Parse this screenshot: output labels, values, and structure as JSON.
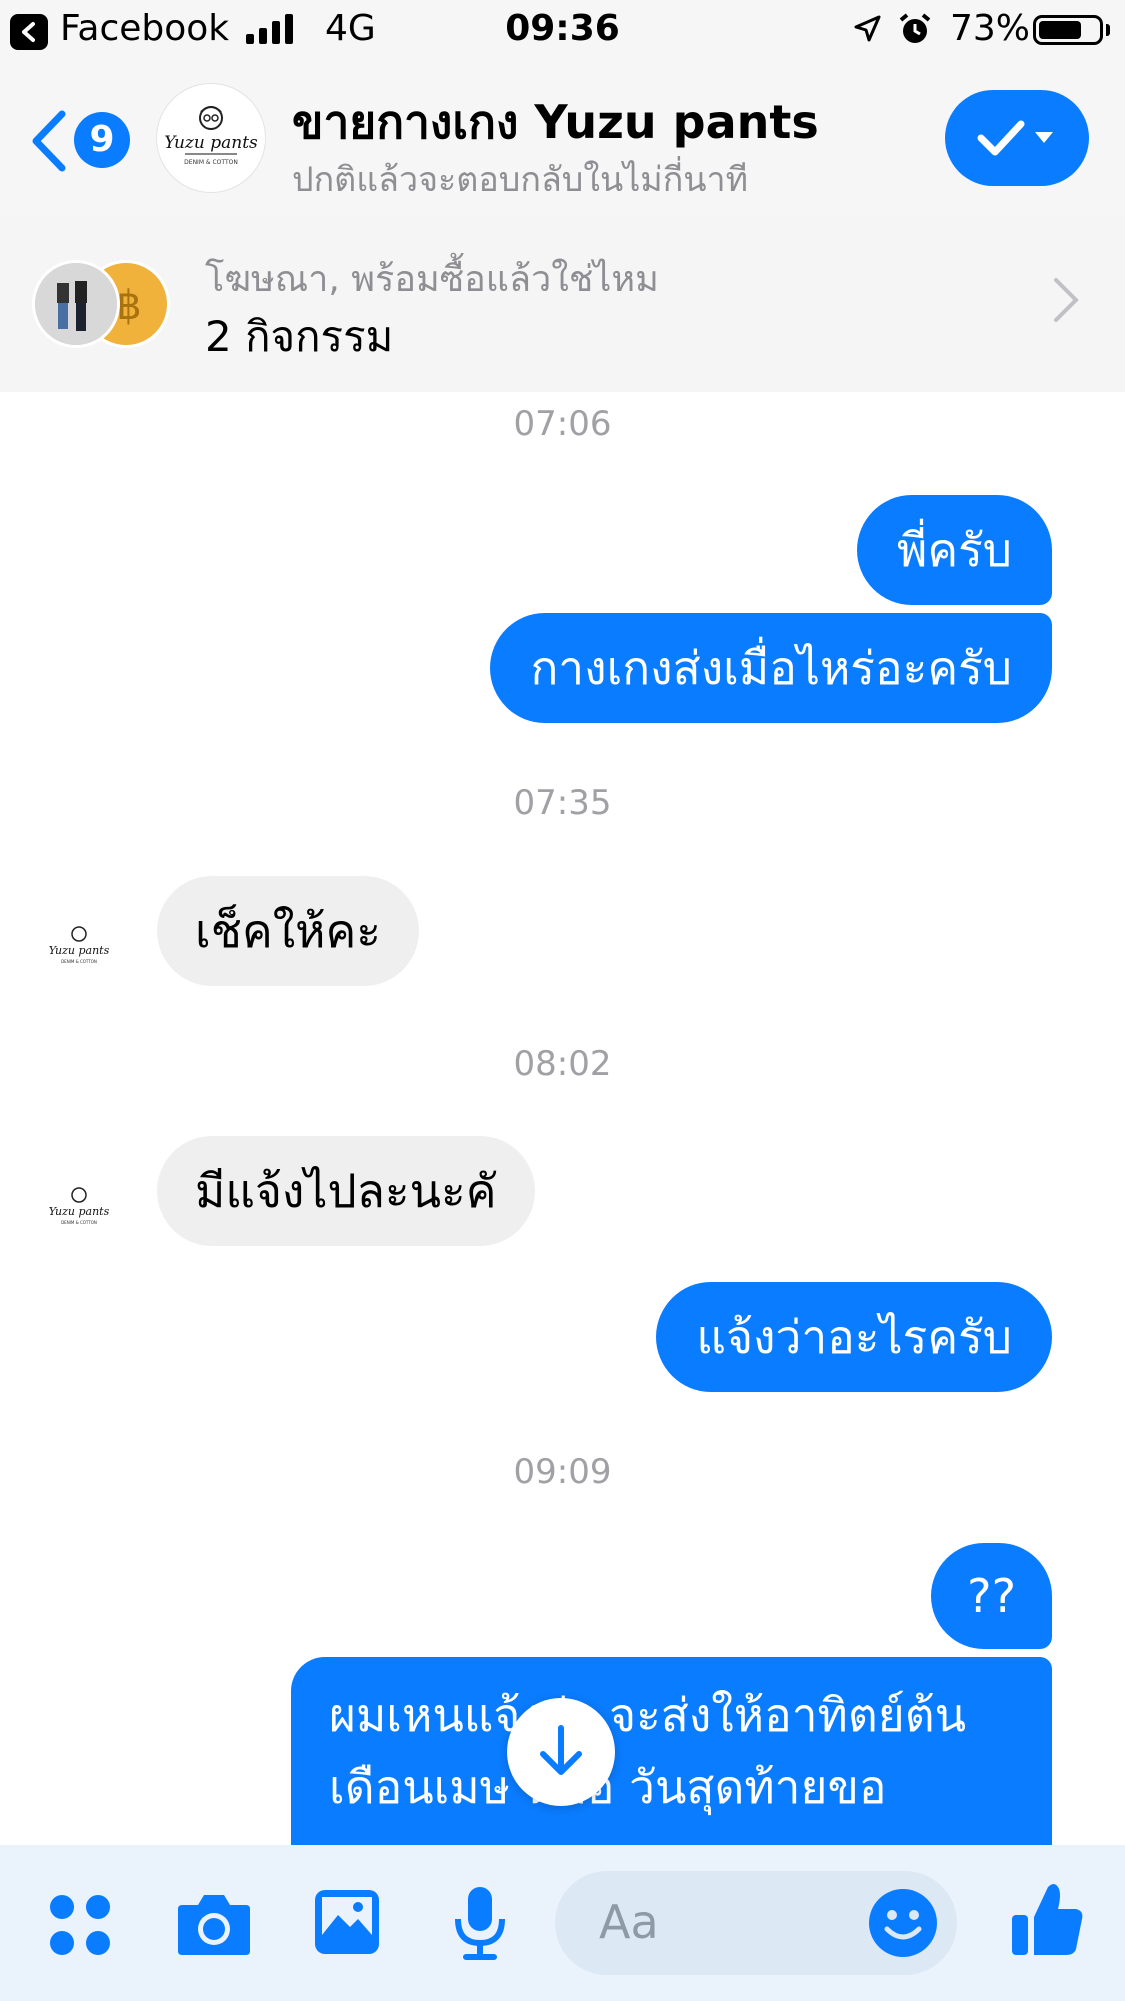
{
  "status_bar": {
    "back_app": "Facebook",
    "network": "4G",
    "time": "09:36",
    "battery_pct": "73%",
    "battery_level": 0.73
  },
  "header": {
    "back_count": "9",
    "title": "ขายกางเกง Yuzu pants",
    "subtitle": "ปกติแล้วจะตอบกลับในไม่กี่นาที",
    "avatar_brand": "Yuzu pants",
    "avatar_small": "DENIM & COTTON"
  },
  "ad_banner": {
    "line1": "โฆษณา, พร้อมซื้อแล้วใช่ไหม",
    "line2": "2 กิจกรรม"
  },
  "messages": [
    {
      "type": "time",
      "text": "07:06"
    },
    {
      "type": "out",
      "text": "พี่ครับ"
    },
    {
      "type": "out",
      "text": "กางเกงส่งเมื่อไหร่อะครับ"
    },
    {
      "type": "time",
      "text": "07:35"
    },
    {
      "type": "in",
      "text": "เช็คให้คะ"
    },
    {
      "type": "time",
      "text": "08:02"
    },
    {
      "type": "in",
      "text": "มีแจ้งไปละนะคั"
    },
    {
      "type": "out",
      "text": "แจ้งว่าอะไรครับ"
    },
    {
      "type": "time",
      "text": "09:09"
    },
    {
      "type": "out",
      "text": "??"
    },
    {
      "type": "out",
      "line1": "ผมเหนแจ้งว่า จะส่งให้อาทิตย์ต้น",
      "line2": "เดือนเมษ นี้คือ วันสุดท้ายขอ"
    }
  ],
  "composer": {
    "placeholder": "Aa"
  },
  "colors": {
    "accent": "#0a7cff",
    "incoming_bubble": "#efefef",
    "timestamp": "#a0a0a5"
  },
  "icons": [
    "back-chevron-icon",
    "checkmark-icon",
    "chevron-right-icon",
    "arrow-down-icon",
    "apps-grid-icon",
    "camera-icon",
    "image-icon",
    "microphone-icon",
    "emoji-icon",
    "thumbs-up-icon"
  ]
}
